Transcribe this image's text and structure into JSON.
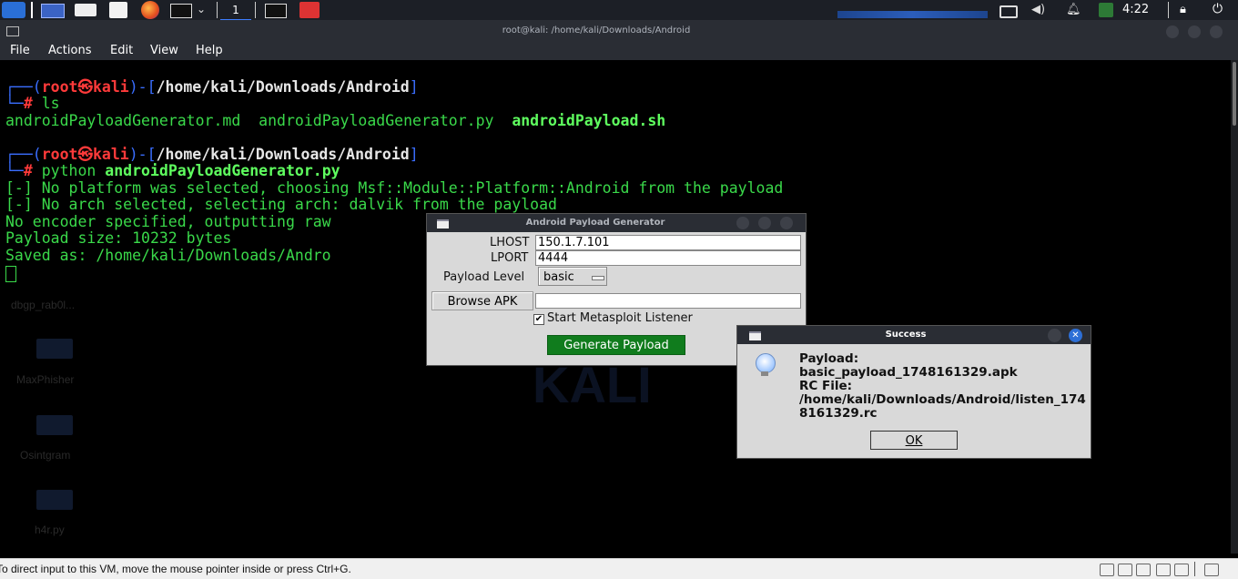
{
  "taskbar": {
    "workspace": "1",
    "clock": "4:22",
    "icons": [
      "kali-menu-icon",
      "desktop-icon",
      "file-manager-icon",
      "text-editor-icon",
      "firefox-icon",
      "terminal-icon",
      "terminal-icon",
      "ipv6-icon",
      "display-icon",
      "volume-icon",
      "bell-icon",
      "battery-icon",
      "lock-icon",
      "power-icon"
    ]
  },
  "terminal": {
    "title": "root@kali: /home/kali/Downloads/Android",
    "menu": [
      "File",
      "Actions",
      "Edit",
      "View",
      "Help"
    ],
    "prompt1": {
      "user": "root",
      "skull": "㉿",
      "host": "kali",
      "path": "/home/kali/Downloads/Android",
      "command": "ls"
    },
    "ls_output": {
      "file1": "androidPayloadGenerator.md",
      "file2": "androidPayloadGenerator.py",
      "file3": "androidPayload.sh"
    },
    "prompt2": {
      "user": "root",
      "skull": "㉿",
      "host": "kali",
      "path": "/home/kali/Downloads/Android",
      "command_prefix": "python",
      "command_arg": "androidPayloadGenerator.py"
    },
    "output_lines": [
      "[-] No platform was selected, choosing Msf::Module::Platform::Android from the payload",
      "[-] No arch selected, selecting arch: dalvik from the payload",
      "No encoder specified, outputting raw",
      "Payload size: 10232 bytes",
      "Saved as: /home/kali/Downloads/Andro"
    ]
  },
  "desktop_ghost": [
    "dbgp_rab0l...",
    "MaxPhisher",
    "Osintgram",
    "h4r.py"
  ],
  "desktop_watermark": "KALI",
  "generator": {
    "title": "Android Payload Generator",
    "lhost_label": "LHOST",
    "lhost_value": "150.1.7.101",
    "lport_label": "LPORT",
    "lport_value": "4444",
    "payload_level_label": "Payload Level",
    "payload_level_value": "basic",
    "browse_label": "Browse APK",
    "apk_value": "",
    "listener_label": "Start Metasploit Listener",
    "listener_checked": true,
    "listener_check_glyph": "✔",
    "generate_label": "Generate Payload",
    "generate_color": "#107c1d"
  },
  "success": {
    "title": "Success",
    "message": "Payload:\nbasic_payload_1748161329.apk\nRC File:\n/home/kali/Downloads/Android/listen_1748161329.rc",
    "ok_label": "OK",
    "close_glyph": "✕"
  },
  "vm_status": {
    "text": "To direct input to this VM, move the mouse pointer inside or press Ctrl+G."
  }
}
